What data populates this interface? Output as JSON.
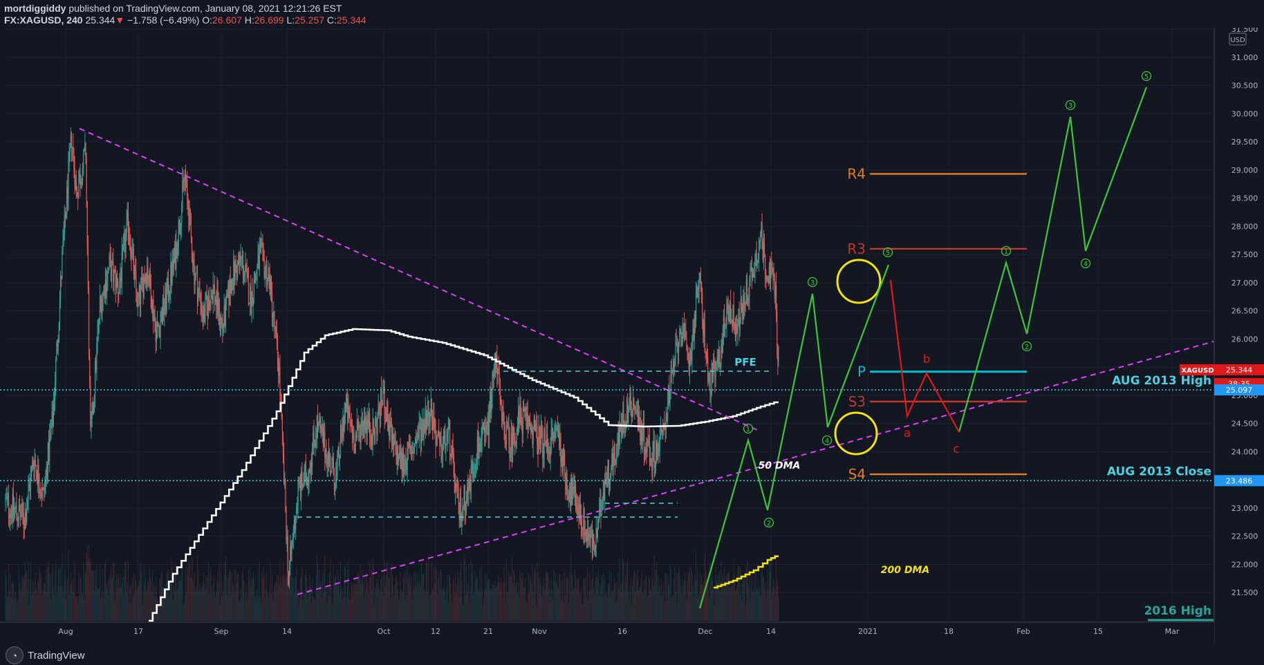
{
  "header": {
    "author": "mortdiggiddy",
    "published_text": "published on TradingView.com, January 08, 2021 12:21:26 EST",
    "symbol": "FX:XAGUSD, 240",
    "last": "25.344",
    "change": "−1.758 (−6.49%)",
    "o_label": "O:",
    "o": "26.607",
    "h_label": "H:",
    "h": "26.699",
    "l_label": "L:",
    "l": "25.257",
    "c_label": "C:",
    "c": "25.344"
  },
  "footer": {
    "logo_text": "TradingView"
  },
  "chart_data": {
    "type": "candlestick",
    "x_ticks": [
      "Aug",
      "17",
      "Sep",
      "14",
      "Oct",
      "12",
      "21",
      "Nov",
      "16",
      "Dec",
      "14",
      "2021",
      "18",
      "Feb",
      "15",
      "Mar"
    ],
    "ylim": [
      21.0,
      31.5
    ],
    "y_ticks": [
      "21.500",
      "22.000",
      "22.500",
      "23.000",
      "23.500",
      "24.000",
      "24.500",
      "25.000",
      "25.500",
      "26.000",
      "26.500",
      "27.000",
      "27.500",
      "28.000",
      "28.500",
      "29.000",
      "29.500",
      "30.000",
      "30.500",
      "31.000",
      "31.500"
    ],
    "currency": "USD",
    "price_badges": [
      {
        "label": "XAGUSD",
        "value": "25.344",
        "color": "#e0191b"
      },
      {
        "label": "",
        "value": "38:35",
        "color": "#e0191b"
      },
      {
        "label": "",
        "value": "25.097",
        "color": "#2196f3"
      },
      {
        "label": "",
        "value": "23.486",
        "color": "#2196f3"
      }
    ],
    "horizontal_levels": [
      {
        "name": "AUG 2013 High",
        "value": 25.097,
        "color": "#4dd0e1"
      },
      {
        "name": "AUG 2013 Close",
        "value": 23.486,
        "color": "#4dd0e1"
      },
      {
        "name": "2016 High",
        "value": 21.0,
        "color": "#26a69a"
      }
    ],
    "pivot_levels": [
      {
        "name": "R4",
        "value": 28.93,
        "color": "#e67e22"
      },
      {
        "name": "R3",
        "value": 27.6,
        "color": "#c0392b"
      },
      {
        "name": "P",
        "value": 25.42,
        "color": "#00bcd4"
      },
      {
        "name": "S3",
        "value": 24.89,
        "color": "#c0392b"
      },
      {
        "name": "S4",
        "value": 23.6,
        "color": "#e67e22"
      }
    ],
    "annotations": {
      "pfe": "PFE",
      "dma50": "50 DMA",
      "dma200": "200 DMA",
      "correction_labels": [
        "a",
        "b",
        "c"
      ],
      "wave_labels": [
        "1",
        "2",
        "3",
        "4",
        "5"
      ]
    },
    "colors": {
      "background": "#131722",
      "up": "#26a69a",
      "down": "#ef5350",
      "trendline": "#e040fb",
      "wave": "#3cc83c",
      "correction": "#e01a1a",
      "highlight_circle": "#f5e30a"
    }
  }
}
